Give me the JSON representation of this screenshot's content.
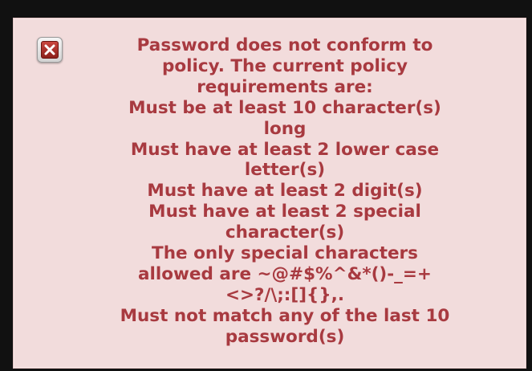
{
  "dialog": {
    "close_icon": "close-x-icon",
    "message_lines": [
      "Password does not conform to",
      "policy. The current policy",
      "requirements are:",
      "Must be at least 10 character(s)",
      "long",
      "Must have at least 2 lower case",
      "letter(s)",
      "Must have at least 2 digit(s)",
      "Must have at least 2 special",
      "character(s)",
      "The only special characters",
      "allowed are ~@#$%^&*()-_=+",
      "<>?/\\;:[]{},.",
      "Must not match any of the last 10",
      "password(s)"
    ]
  },
  "colors": {
    "panel_background": "#f2dcdc",
    "message_text": "#a83a40",
    "close_icon_red": "#a8302a"
  }
}
